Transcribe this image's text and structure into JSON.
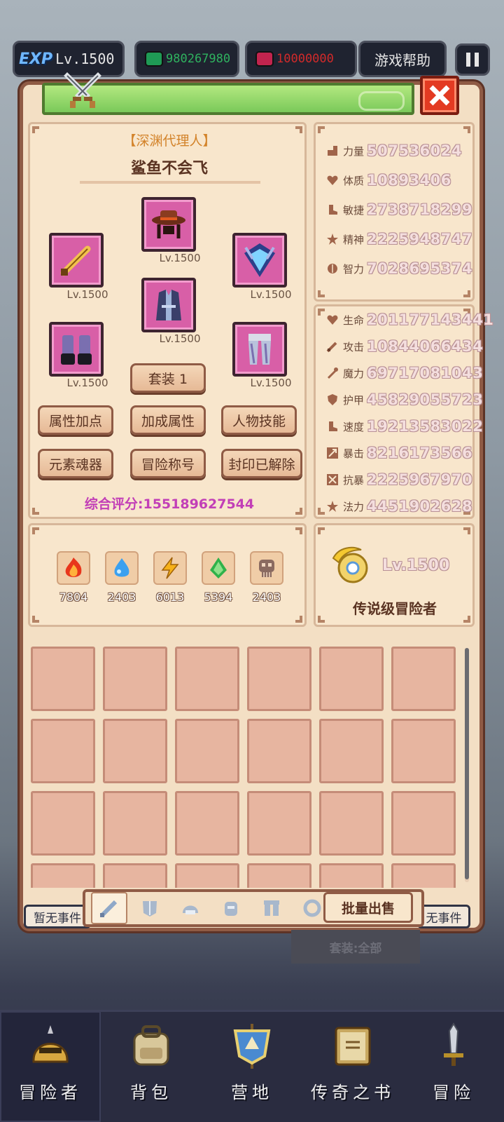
{
  "hud": {
    "exp_badge": "EXP",
    "level": "Lv.1500",
    "gems": "980267980",
    "rubies": "10000000",
    "help_label": "游戏帮助"
  },
  "character": {
    "title": "【深渊代理人】",
    "name": "鲨鱼不会飞",
    "score": "综合评分:155189627544",
    "equipment": [
      {
        "slot": "weapon",
        "level": "Lv.1500"
      },
      {
        "slot": "helmet",
        "level": "Lv.1500"
      },
      {
        "slot": "amulet",
        "level": "Lv.1500"
      },
      {
        "slot": "armor",
        "level": "Lv.1500"
      },
      {
        "slot": "gloves",
        "level": "Lv.1500"
      },
      {
        "slot": "pants",
        "level": "Lv.1500"
      }
    ],
    "set_label": "套装 1",
    "buttons": [
      "属性加点",
      "加成属性",
      "人物技能",
      "元素魂器",
      "冒险称号",
      "封印已解除"
    ]
  },
  "elements": [
    {
      "name": "fire",
      "value": "7804"
    },
    {
      "name": "water",
      "value": "2403"
    },
    {
      "name": "thunder",
      "value": "6013"
    },
    {
      "name": "wood",
      "value": "5394"
    },
    {
      "name": "dark",
      "value": "2403"
    }
  ],
  "base_stats": [
    {
      "label": "力量",
      "value": "507536024"
    },
    {
      "label": "体质",
      "value": "10893406"
    },
    {
      "label": "敏捷",
      "value": "2738718299"
    },
    {
      "label": "精神",
      "value": "2225948747"
    },
    {
      "label": "智力",
      "value": "7028695374"
    }
  ],
  "combat_stats": [
    {
      "label": "生命",
      "value": "201177143441"
    },
    {
      "label": "攻击",
      "value": "10844066434"
    },
    {
      "label": "魔力",
      "value": "69717081043"
    },
    {
      "label": "护甲",
      "value": "45829055723"
    },
    {
      "label": "速度",
      "value": "19213583022"
    },
    {
      "label": "暴击",
      "value": "8216173566"
    },
    {
      "label": "抗暴",
      "value": "2225967970"
    },
    {
      "label": "法力",
      "value": "4451902628"
    }
  ],
  "rank": {
    "level": "Lv.1500",
    "title": "传说级冒险者"
  },
  "inventory": {
    "bulk_sell": "批量出售",
    "filter": "套装:全部"
  },
  "events": {
    "left": "暂无事件",
    "right": "无事件"
  },
  "nav": [
    "冒险者",
    "背包",
    "营地",
    "传奇之书",
    "冒险"
  ],
  "colors": {
    "accent_pink": "#d85fa7",
    "panel_bg": "#f3dfc4",
    "border_brown": "#8f5b45",
    "score_purple": "#c23fb7"
  }
}
